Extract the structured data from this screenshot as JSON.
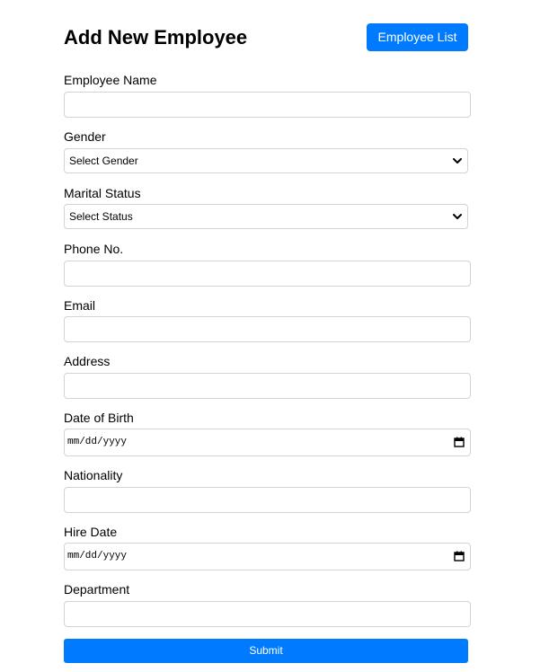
{
  "header": {
    "title": "Add New Employee",
    "list_button": "Employee List"
  },
  "form": {
    "employee_name": {
      "label": "Employee Name",
      "value": ""
    },
    "gender": {
      "label": "Gender",
      "selected": "Select Gender"
    },
    "marital_status": {
      "label": "Marital Status",
      "selected": "Select Status"
    },
    "phone": {
      "label": "Phone No.",
      "value": ""
    },
    "email": {
      "label": "Email",
      "value": ""
    },
    "address": {
      "label": "Address",
      "value": ""
    },
    "date_of_birth": {
      "label": "Date of Birth",
      "placeholder": "mm/dd/yyyy"
    },
    "nationality": {
      "label": "Nationality",
      "value": ""
    },
    "hire_date": {
      "label": "Hire Date",
      "placeholder": "mm/dd/yyyy"
    },
    "department": {
      "label": "Department",
      "value": ""
    },
    "submit_label": "Submit"
  },
  "colors": {
    "primary": "#007bff",
    "input_border": "#cfd4da"
  },
  "icons": {
    "select_arrow": "chevron-down-icon",
    "date_picker": "calendar-icon"
  }
}
